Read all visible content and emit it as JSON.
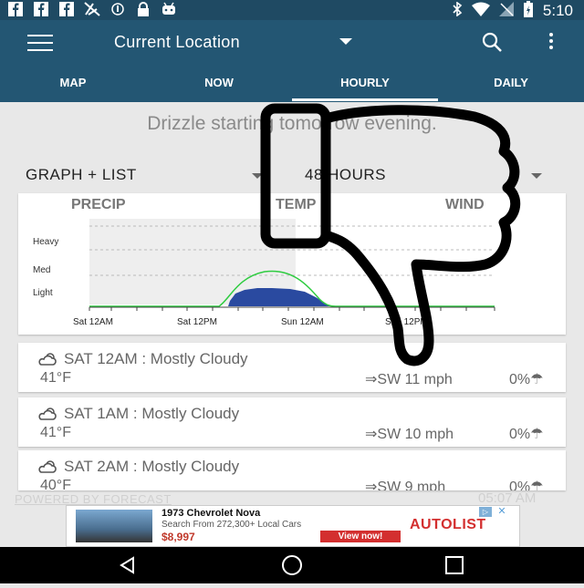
{
  "status_bar": {
    "time": "5:10",
    "left_icons": [
      "facebook-icon",
      "facebook-icon",
      "facebook-icon",
      "no-signal-icon",
      "vpn-icon",
      "lock-icon",
      "android-icon"
    ],
    "right_icons": [
      "bluetooth-icon",
      "wifi-icon",
      "signal-icon",
      "battery-icon"
    ]
  },
  "toolbar": {
    "title": "Current Location"
  },
  "tabs": [
    {
      "label": "MAP"
    },
    {
      "label": "NOW"
    },
    {
      "label": "HOURLY",
      "active": true
    },
    {
      "label": "DAILY"
    }
  ],
  "summary": "Drizzle starting tomorrow evening.",
  "controls": {
    "view_mode": "GRAPH + LIST",
    "range": "48 HOURS"
  },
  "graph": {
    "tabs": [
      "PRECIP",
      "TEMP",
      "WIND"
    ],
    "y_labels": [
      "Heavy",
      "Med",
      "Light"
    ],
    "x_labels": [
      "Sat 12AM",
      "Sat 12PM",
      "Sun 12AM",
      "Sun 12PM"
    ]
  },
  "hourly": [
    {
      "title": "SAT 12AM : Mostly Cloudy",
      "temp": "41°F",
      "wind": "SW 11 mph",
      "precip": "0%"
    },
    {
      "title": "SAT 1AM : Mostly Cloudy",
      "temp": "41°F",
      "wind": "SW 10 mph",
      "precip": "0%"
    },
    {
      "title": "SAT 2AM : Mostly Cloudy",
      "temp": "40°F",
      "wind": "SW 9 mph",
      "precip": "0%"
    }
  ],
  "footer": {
    "powered_by": "POWERED BY FORECAST",
    "updated": "05:07 AM"
  },
  "ad": {
    "title": "1973 Chevrolet Nova",
    "subtitle": "Search From 272,300+ Local Cars",
    "price": "$8,997",
    "cta": "View now!",
    "brand": "AUTOLIST"
  },
  "colors": {
    "status_bar": "#1f4a63",
    "app_bar": "#235673",
    "precip_fill": "#2a4aa0",
    "precip_line": "#2ecc40"
  }
}
